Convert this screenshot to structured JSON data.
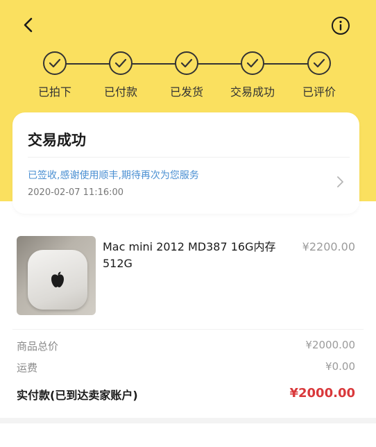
{
  "colors": {
    "header_bg": "#fae05f",
    "link_blue": "#4a8fd2",
    "price_red": "#d9383b"
  },
  "header": {
    "back_icon": "chevron-left-icon",
    "info_icon": "info-circle-icon"
  },
  "progress": {
    "steps": [
      {
        "label": "已拍下",
        "done": true
      },
      {
        "label": "已付款",
        "done": true
      },
      {
        "label": "已发货",
        "done": true
      },
      {
        "label": "交易成功",
        "done": true
      },
      {
        "label": "已评价",
        "done": true
      }
    ]
  },
  "status_card": {
    "title": "交易成功",
    "message": "已签收,感谢使用顺丰,期待再次为您服务",
    "time": "2020-02-07 11:16:00"
  },
  "product": {
    "name": "Mac mini 2012 MD387 16G内存 512G",
    "price": "¥2200.00"
  },
  "summary": {
    "total_label": "商品总价",
    "total_value": "¥2000.00",
    "shipping_label": "运费",
    "shipping_value": "¥0.00",
    "paid_label": "实付款(已到达卖家账户)",
    "paid_value": "¥2000.00"
  }
}
